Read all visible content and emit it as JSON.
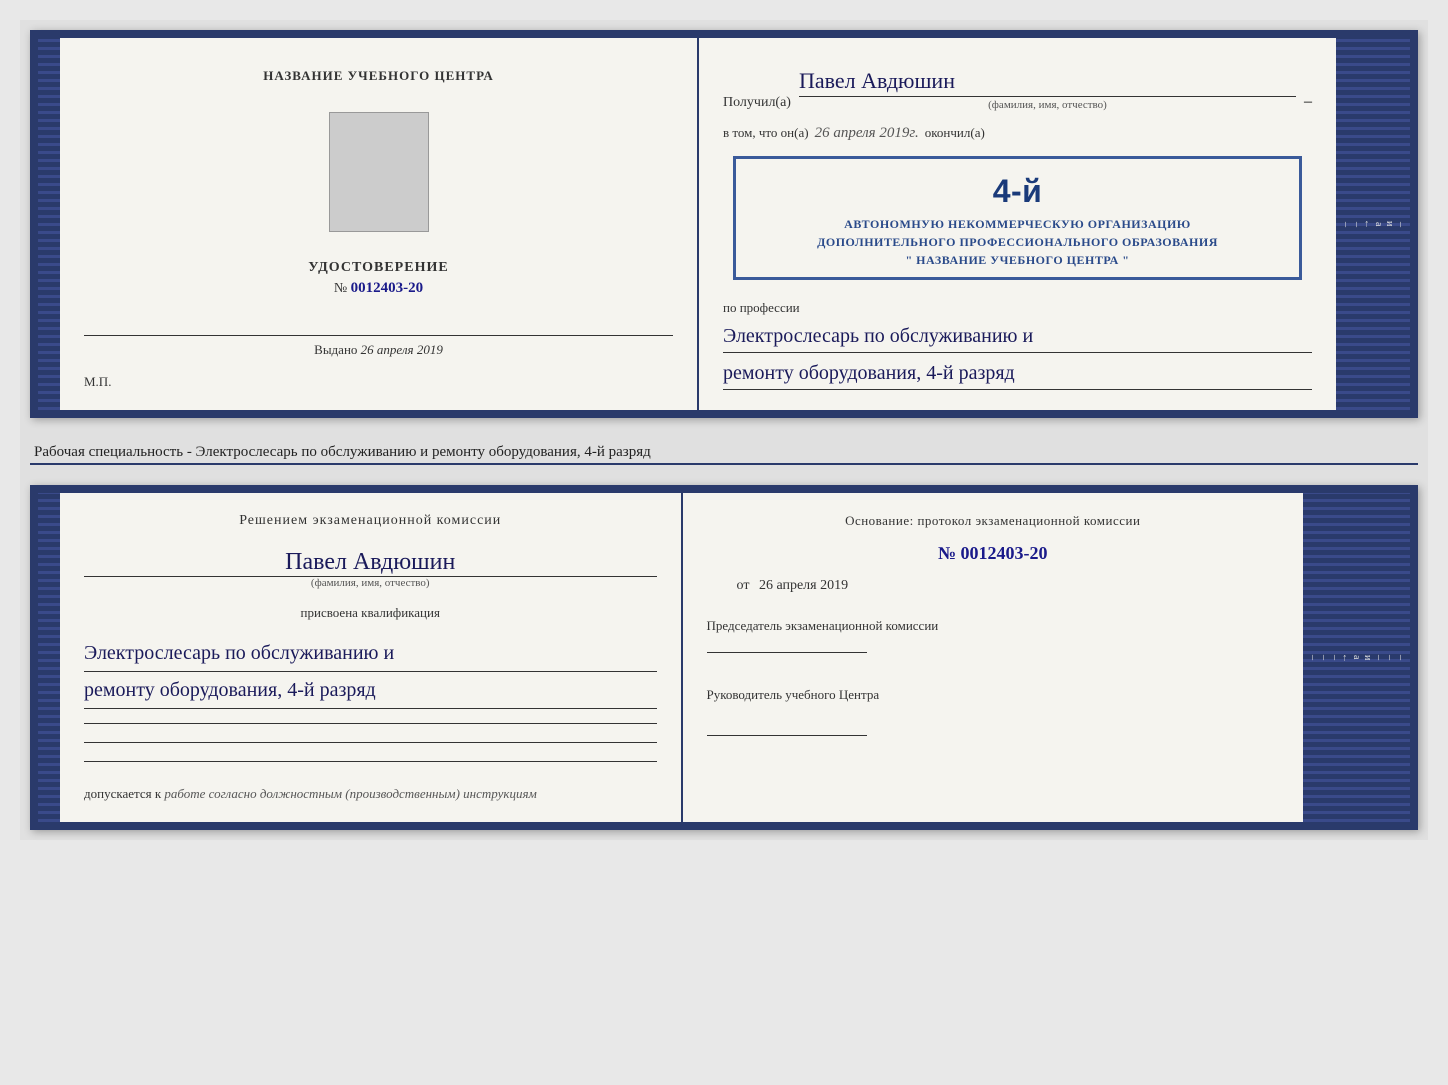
{
  "doc_top": {
    "left": {
      "org_name": "НАЗВАНИЕ УЧЕБНОГО ЦЕНТРА",
      "cert_type": "УДОСТОВЕРЕНИЕ",
      "cert_number_label": "№",
      "cert_number": "0012403-20",
      "issued_label": "Выдано",
      "issued_date": "26 апреля 2019",
      "mp_label": "М.П."
    },
    "right": {
      "received_label": "Получил(а)",
      "recipient_name": "Павел Авдюшин",
      "fio_caption": "(фамилия, имя, отчество)",
      "info_prefix": "в том, что он(а)",
      "info_date": "26 апреля 2019г.",
      "info_suffix": "окончил(а)",
      "stamp_grade": "4-й",
      "stamp_line1": "АВТОНОМНУЮ НЕКОММЕРЧЕСКУЮ ОРГАНИЗАЦИЮ",
      "stamp_line2": "ДОПОЛНИТЕЛЬНОГО ПРОФЕССИОНАЛЬНОГО ОБРАЗОВАНИЯ",
      "stamp_line3": "\" НАЗВАНИЕ УЧЕБНОГО ЦЕНТРА \"",
      "profession_label": "по профессии",
      "profession_line1": "Электрослесарь по обслуживанию и",
      "profession_line2": "ремонту оборудования, 4-й разряд"
    }
  },
  "specialty_text": "Рабочая специальность - Электрослесарь по обслуживанию и ремонту оборудования, 4-й разряд",
  "doc_bottom": {
    "left": {
      "decision_label": "Решением экзаменационной комиссии",
      "recipient_name": "Павел Авдюшин",
      "fio_caption": "(фамилия, имя, отчество)",
      "qual_label": "присвоена квалификация",
      "profession_line1": "Электрослесарь по обслуживанию и",
      "profession_line2": "ремонту оборудования, 4-й разряд",
      "allowed_prefix": "допускается к",
      "allowed_text": "работе согласно должностным (производственным) инструкциям"
    },
    "right": {
      "basis_label": "Основание: протокол экзаменационной комиссии",
      "number_prefix": "№",
      "number_value": "0012403-20",
      "date_prefix": "от",
      "date_value": "26 апреля 2019",
      "chairman_label": "Председатель экзаменационной комиссии",
      "director_label": "Руководитель учебного Центра"
    }
  },
  "side_labels": {
    "items": [
      "и",
      "а",
      "←",
      "–",
      "–",
      "–"
    ]
  }
}
